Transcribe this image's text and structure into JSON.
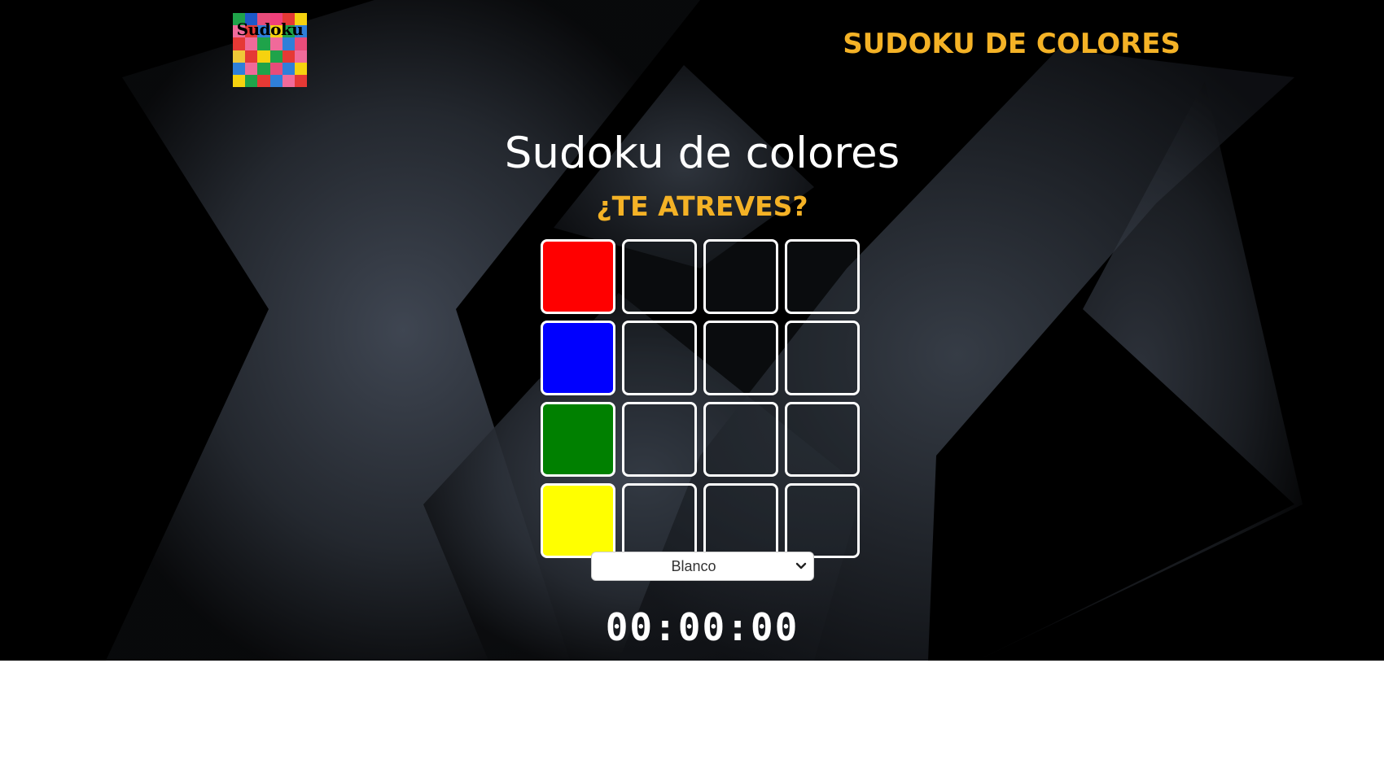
{
  "header": {
    "logo_text": "Sudoku",
    "title": "SUDOKU DE COLORES"
  },
  "main": {
    "title": "Sudoku de colores",
    "subtitle": "¿TE ATREVES?"
  },
  "board": {
    "rows": [
      [
        "#ff0000",
        "",
        "",
        ""
      ],
      [
        "#0000ff",
        "",
        "",
        ""
      ],
      [
        "#008000",
        "",
        "",
        ""
      ],
      [
        "#ffff00",
        "",
        "",
        ""
      ]
    ]
  },
  "color_select": {
    "selected": "Blanco"
  },
  "timer": {
    "value": "00:00:00"
  },
  "colors": {
    "accent": "#f4b226",
    "background": "#000000"
  },
  "icons": {
    "select": "chevron-down-icon"
  }
}
